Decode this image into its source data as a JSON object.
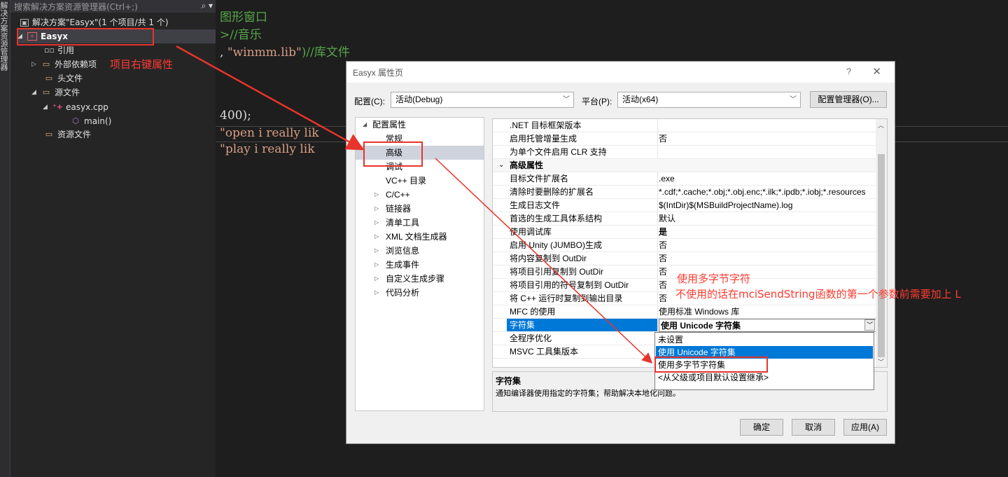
{
  "vertical_tab": {
    "text": "解决方案资源管理器"
  },
  "solution_explorer": {
    "search_placeholder": "搜索解决方案资源管理器(Ctrl+;)",
    "search_icon": "search-icon",
    "nodes": [
      {
        "label": "解决方案\"Easyx\"(1 个项目/共 1 个)",
        "icon": "solution-icon"
      },
      {
        "label": "Easyx",
        "icon": "project-icon"
      },
      {
        "label": "引用",
        "icon": "references-icon"
      },
      {
        "label": "外部依赖项",
        "icon": "folder-icon"
      },
      {
        "label": "头文件",
        "icon": "folder-icon"
      },
      {
        "label": "源文件",
        "icon": "folder-icon"
      },
      {
        "label": "easyx.cpp",
        "icon": "cpp-file-icon"
      },
      {
        "label": "main()",
        "icon": "function-icon"
      },
      {
        "label": "资源文件",
        "icon": "folder-icon"
      }
    ]
  },
  "code": {
    "lines": [
      {
        "parts": [
          {
            "t": "图形窗口",
            "c": "green"
          }
        ]
      },
      {
        "parts": [
          {
            "t": ">//音乐",
            "c": "green"
          }
        ]
      },
      {
        "parts": [
          {
            "t": ", ",
            "c": "white"
          },
          {
            "t": "\"winmm.lib\"",
            "c": "str"
          },
          {
            "t": ")//库文件",
            "c": "green"
          }
        ]
      },
      {
        "parts": [
          {
            "t": "400);",
            "c": "white"
          }
        ]
      },
      {
        "parts": [
          {
            "t": "\"open i really lik",
            "c": "str"
          }
        ]
      },
      {
        "parts": [
          {
            "t": "\"play i really lik",
            "c": "str"
          }
        ]
      }
    ]
  },
  "dialog": {
    "title": "Easyx 属性页",
    "help_label": "?",
    "close_label": "✕",
    "config_label": "配置(C):",
    "config_value": "活动(Debug)",
    "platform_label": "平台(P):",
    "platform_value": "活动(x64)",
    "config_manager_label": "配置管理器(O)...",
    "tree": [
      {
        "label": "配置属性",
        "arrow": "◢"
      },
      {
        "label": "常规",
        "arrow": ""
      },
      {
        "label": "高级",
        "arrow": ""
      },
      {
        "label": "调试",
        "arrow": ""
      },
      {
        "label": "VC++ 目录",
        "arrow": ""
      },
      {
        "label": "C/C++",
        "arrow": "▷"
      },
      {
        "label": "链接器",
        "arrow": "▷"
      },
      {
        "label": "清单工具",
        "arrow": "▷"
      },
      {
        "label": "XML 文档生成器",
        "arrow": "▷"
      },
      {
        "label": "浏览信息",
        "arrow": "▷"
      },
      {
        "label": "生成事件",
        "arrow": "▷"
      },
      {
        "label": "自定义生成步骤",
        "arrow": "▷"
      },
      {
        "label": "代码分析",
        "arrow": "▷"
      }
    ],
    "properties": [
      {
        "key": ".NET 目标框架版本",
        "value": ""
      },
      {
        "key": "启用托管增量生成",
        "value": "否"
      },
      {
        "key": "为单个文件启用 CLR 支持",
        "value": ""
      },
      {
        "key": "高级属性",
        "value": "",
        "category": true
      },
      {
        "key": "目标文件扩展名",
        "value": ".exe"
      },
      {
        "key": "清除时要删除的扩展名",
        "value": "*.cdf;*.cache;*.obj;*.obj.enc;*.ilk;*.ipdb;*.iobj;*.resources"
      },
      {
        "key": "生成日志文件",
        "value": "$(IntDir)$(MSBuildProjectName).log"
      },
      {
        "key": "首选的生成工具体系结构",
        "value": "默认"
      },
      {
        "key": "使用调试库",
        "value": "是",
        "bold": true
      },
      {
        "key": "启用 Unity (JUMBO)生成",
        "value": "否"
      },
      {
        "key": "将内容复制到 OutDir",
        "value": "否"
      },
      {
        "key": "将项目引用复制到 OutDir",
        "value": "否"
      },
      {
        "key": "将项目引用的符号复制到 OutDir",
        "value": "否"
      },
      {
        "key": "将 C++ 运行时复制到输出目录",
        "value": "否"
      },
      {
        "key": "MFC 的使用",
        "value": "使用标准 Windows 库"
      },
      {
        "key": "字符集",
        "value": "使用 Unicode 字符集",
        "bold": true,
        "highlight": true
      },
      {
        "key": "全程序优化",
        "value": ""
      },
      {
        "key": "MSVC 工具集版本",
        "value": ""
      }
    ],
    "dropdown_options": [
      "未设置",
      "使用 Unicode 字符集",
      "使用多字节字符集",
      "<从父级或项目默认设置继承>"
    ],
    "dropdown_selected": 1,
    "desc_title": "字符集",
    "desc_text": "通知编译器使用指定的字符集；帮助解决本地化问题。",
    "ok_label": "确定",
    "cancel_label": "取消",
    "apply_label": "应用(A)"
  },
  "annotations": {
    "project_note": "项目右键属性",
    "note_line1": "使用多字节字符",
    "note_line2": "不使用的话在mciSendString函数的第一个参数前需要加上 L",
    "color": "#ff3b30"
  }
}
